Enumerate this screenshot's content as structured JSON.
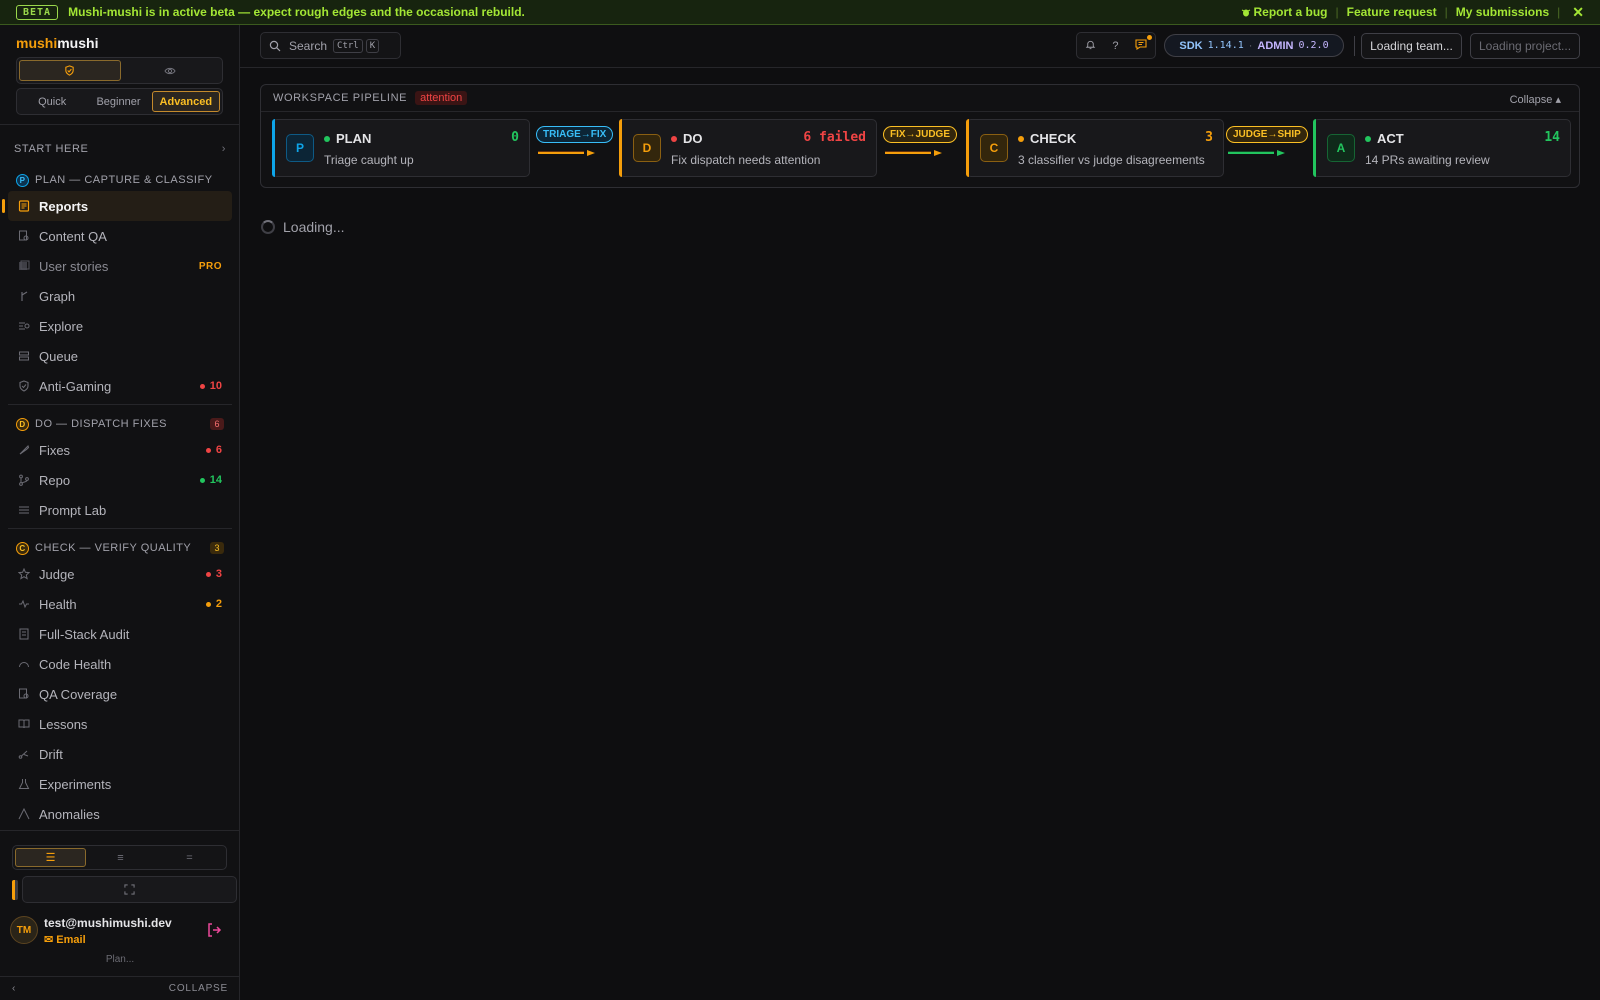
{
  "banner": {
    "tag": "BETA",
    "message": "Mushi-mushi is in active beta — expect rough edges and the occasional rebuild.",
    "report_bug": "Report a bug",
    "feature_request": "Feature request",
    "my_submissions": "My submissions",
    "separator": "|",
    "close": "✕"
  },
  "sidebar": {
    "brand_a": "mushi",
    "brand_b": "mushi",
    "levels": [
      "Quick",
      "Beginner",
      "Advanced"
    ],
    "start_here": "START HERE",
    "sections": [
      {
        "letter": "P",
        "title": "PLAN — CAPTURE & CLASSIFY",
        "badge": "",
        "items": [
          {
            "label": "Reports",
            "icon": "report-icon",
            "count": "",
            "active": true
          },
          {
            "label": "Content QA",
            "icon": "content-qa-icon",
            "count": ""
          },
          {
            "label": "User stories",
            "icon": "user-stories-icon",
            "count": "",
            "pro": "PRO"
          },
          {
            "label": "Graph",
            "icon": "graph-icon",
            "count": ""
          },
          {
            "label": "Explore",
            "icon": "explore-icon",
            "count": ""
          },
          {
            "label": "Queue",
            "icon": "queue-icon",
            "count": ""
          },
          {
            "label": "Anti-Gaming",
            "icon": "shield-icon",
            "count": "10",
            "dot": "#ef4444"
          }
        ]
      },
      {
        "letter": "D",
        "title": "DO — DISPATCH FIXES",
        "badge": "6",
        "items": [
          {
            "label": "Fixes",
            "icon": "wrench-icon",
            "count": "6",
            "dot": "#ef4444"
          },
          {
            "label": "Repo",
            "icon": "branch-icon",
            "count": "14",
            "dot": "#22c55e"
          },
          {
            "label": "Prompt Lab",
            "icon": "prompt-lab-icon",
            "count": ""
          }
        ]
      },
      {
        "letter": "C",
        "title": "CHECK — VERIFY QUALITY",
        "badge": "3",
        "items": [
          {
            "label": "Judge",
            "icon": "star-icon",
            "count": "3",
            "dot": "#ef4444"
          },
          {
            "label": "Health",
            "icon": "pulse-icon",
            "count": "2",
            "dot": "#f59e0b"
          },
          {
            "label": "Full-Stack Audit",
            "icon": "audit-icon",
            "count": ""
          },
          {
            "label": "Code Health",
            "icon": "code-health-icon",
            "count": ""
          },
          {
            "label": "QA Coverage",
            "icon": "qa-coverage-icon",
            "count": ""
          },
          {
            "label": "Lessons",
            "icon": "book-icon",
            "count": ""
          },
          {
            "label": "Drift",
            "icon": "drift-icon",
            "count": ""
          },
          {
            "label": "Experiments",
            "icon": "flask-icon",
            "count": ""
          },
          {
            "label": "Anomalies",
            "icon": "anomaly-icon",
            "count": ""
          }
        ]
      }
    ],
    "user": {
      "initials": "TM",
      "email": "test@mushimushi.dev",
      "method": "Email",
      "plan": "Plan..."
    },
    "collapse": "COLLAPSE"
  },
  "topbar": {
    "search_label": "Search",
    "kbd_1": "Ctrl",
    "kbd_2": "K",
    "sdk_key": "SDK",
    "sdk_version": "1.14.1",
    "dot": "·",
    "admin_key": "ADMIN",
    "admin_version": "0.2.0",
    "team": "Loading team...",
    "project": "Loading project..."
  },
  "pipeline": {
    "title": "WORKSPACE PIPELINE",
    "status": "attention",
    "collapse": "Collapse ▴",
    "stages": [
      {
        "letter": "P",
        "name": "PLAN",
        "desc": "Triage caught up",
        "value": "0",
        "color": "#0ea5e9",
        "dot": "#22c55e",
        "value_color": "#22c55e"
      },
      {
        "letter": "D",
        "name": "DO",
        "desc": "Fix dispatch needs attention",
        "value": "6 failed",
        "color": "#f59e0b",
        "dot": "#ef4444",
        "value_color": "#ef4444"
      },
      {
        "letter": "C",
        "name": "CHECK",
        "desc": "3 classifier vs judge disagreements",
        "value": "3",
        "color": "#f59e0b",
        "dot": "#f59e0b",
        "value_color": "#f59e0b"
      },
      {
        "letter": "A",
        "name": "ACT",
        "desc": "14 PRs awaiting review",
        "value": "14",
        "color": "#22c55e",
        "dot": "#22c55e",
        "value_color": "#22c55e"
      }
    ],
    "transitions": [
      {
        "label": "TRIAGE→FIX",
        "color": "#38bdf8",
        "arrow": "#f59e0b"
      },
      {
        "label": "FIX→JUDGE",
        "color": "#fbbf24",
        "arrow": "#f59e0b"
      },
      {
        "label": "JUDGE→SHIP",
        "color": "#fbbf24",
        "arrow": "#22c55e"
      }
    ]
  },
  "main": {
    "loading": "Loading..."
  }
}
